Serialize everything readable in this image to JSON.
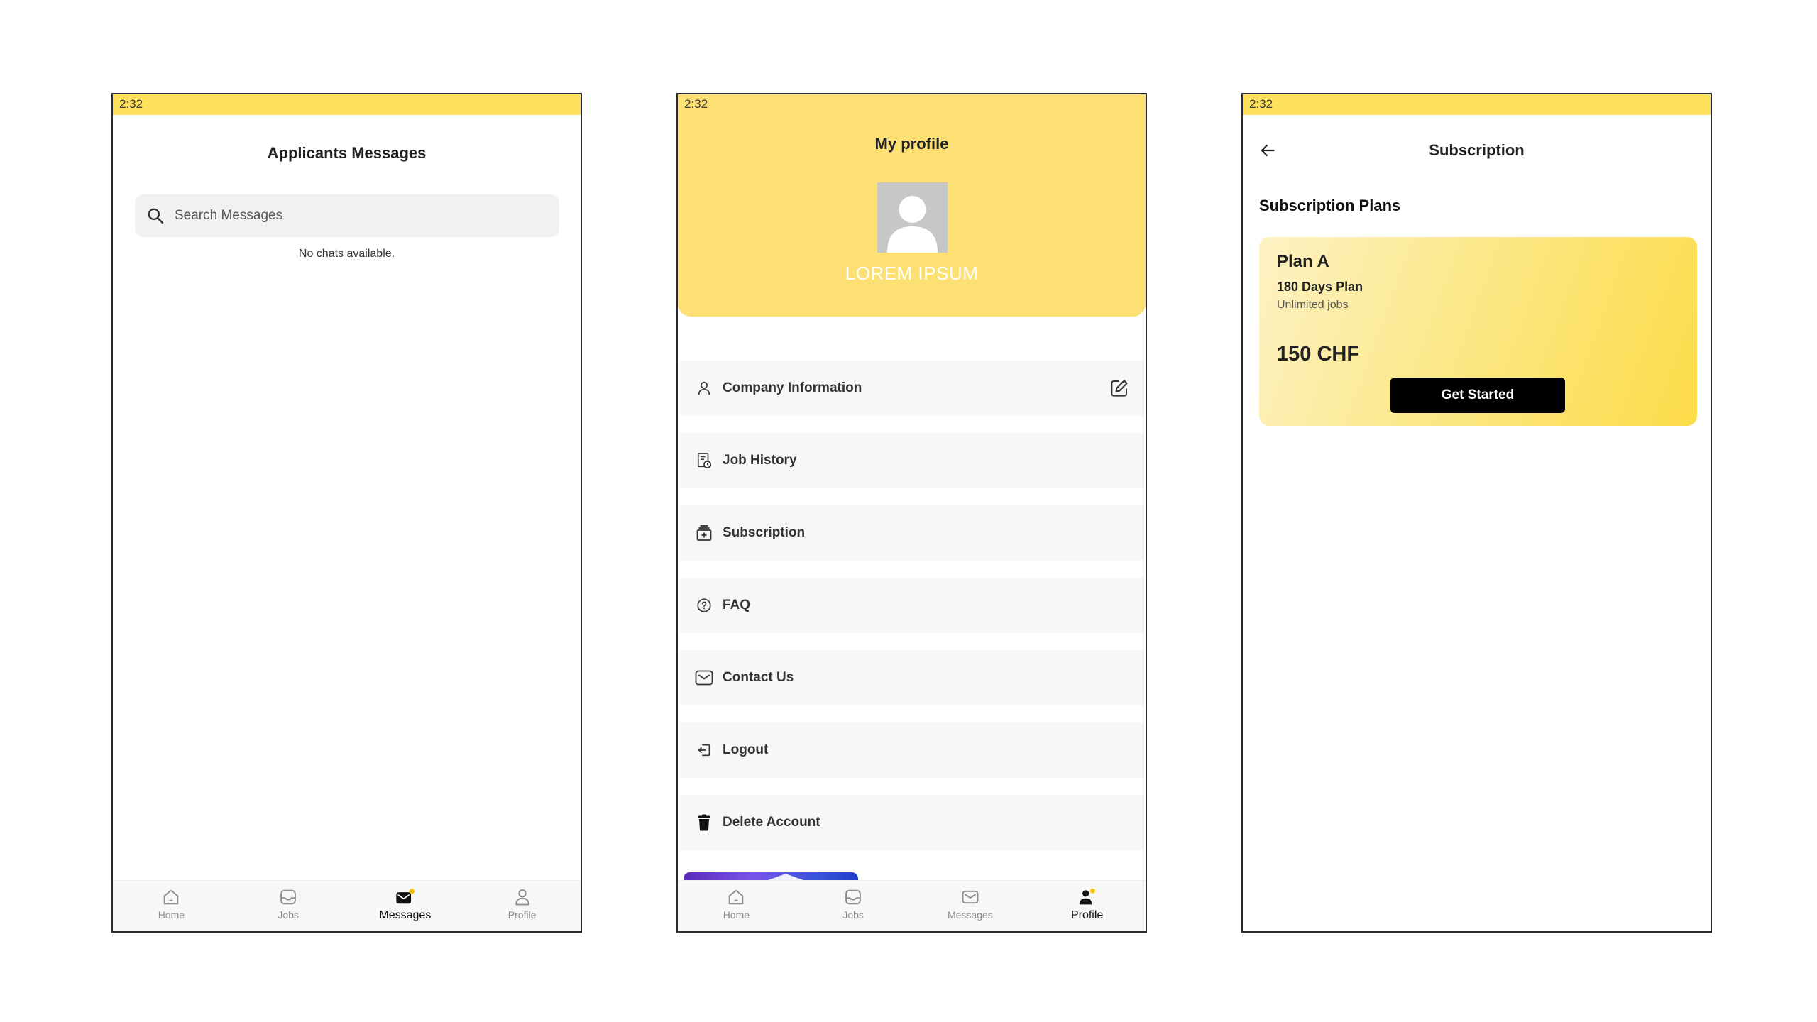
{
  "screen_messages": {
    "status_time": "2:32",
    "title": "Applicants Messages",
    "search": {
      "placeholder": "Search Messages"
    },
    "empty_text": "No chats available."
  },
  "screen_profile": {
    "status_time": "2:32",
    "title": "My profile",
    "name": "LOREM IPSUM",
    "menu": [
      {
        "label": "Company Information",
        "icon": "person-icon"
      },
      {
        "label": "Job History",
        "icon": "job-history-icon"
      },
      {
        "label": "Subscription",
        "icon": "subscription-icon"
      },
      {
        "label": "FAQ",
        "icon": "help-circle-icon"
      },
      {
        "label": "Contact Us",
        "icon": "mail-icon"
      },
      {
        "label": "Logout",
        "icon": "logout-icon"
      },
      {
        "label": "Delete Account",
        "icon": "trash-icon"
      }
    ]
  },
  "screen_subscription": {
    "status_time": "2:32",
    "title": "Subscription",
    "section_title": "Subscription Plans",
    "plan": {
      "name": "Plan A",
      "duration": "180 Days Plan",
      "description": "Unlimited jobs",
      "price": "150 CHF",
      "cta": "Get Started"
    }
  },
  "bottom_nav": {
    "items": [
      {
        "label": "Home",
        "icon": "home-icon"
      },
      {
        "label": "Jobs",
        "icon": "jobs-icon"
      },
      {
        "label": "Messages",
        "icon": "messages-icon"
      },
      {
        "label": "Profile",
        "icon": "profile-icon"
      }
    ]
  },
  "colors": {
    "accent_yellow": "#fde05b",
    "profile_header": "#fde074",
    "button_black": "#000000",
    "badge_yellow": "#f5c400"
  }
}
